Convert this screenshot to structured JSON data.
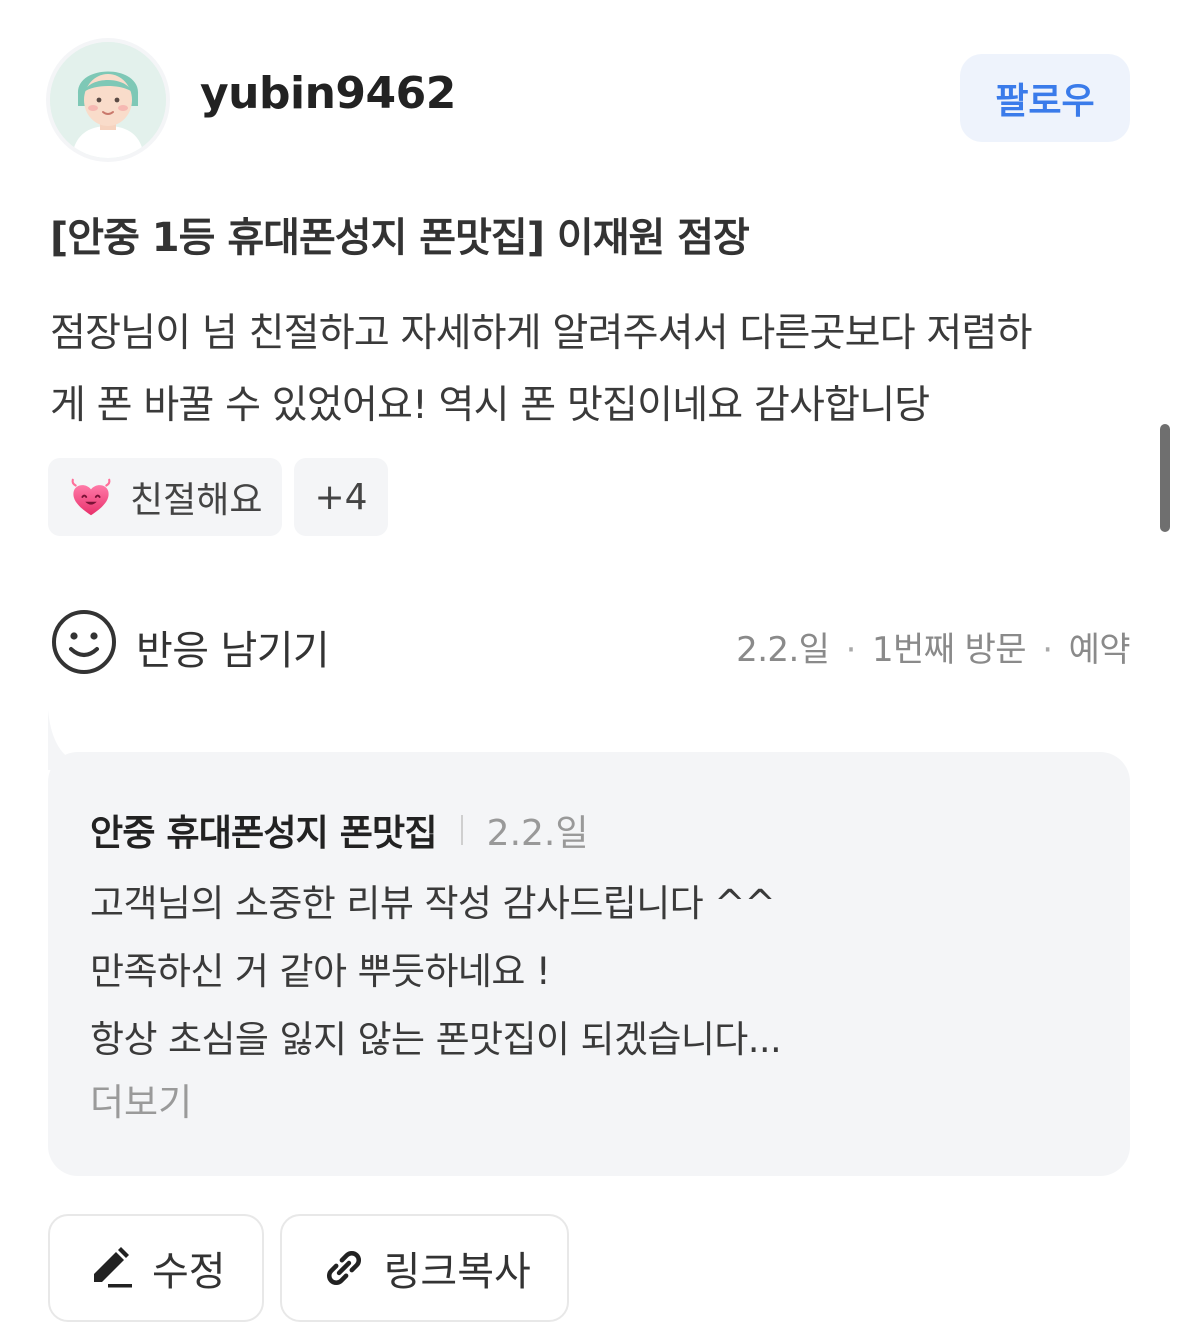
{
  "profile": {
    "username": "yubin9462",
    "follow_label": "팔로우"
  },
  "review": {
    "title": "[안중 1등 휴대폰성지 폰맛집] 이재원 점장",
    "body_lines": [
      "점장님이 넘 친절하고 자세하게 알려주셔서 다른곳보다 저렴하",
      "게 폰 바꿀 수 있었어요! 역시 폰 맛집이네요 감사합니당"
    ],
    "tags": [
      {
        "icon": "heart-smile-icon",
        "label": "친절해요"
      },
      {
        "label": "+4"
      }
    ]
  },
  "reaction": {
    "label": "반응 남기기",
    "date": "2.2.일",
    "visit": "1번째 방문",
    "type": "예약",
    "dot": "·"
  },
  "reply": {
    "store_name": "안중 휴대폰성지 폰맛집",
    "date": "2.2.일",
    "lines": [
      "고객님의 소중한 리뷰 작성 감사드립니다 ^^",
      "만족하신 거 같아 뿌듯하네요 !",
      "항상 초심을 잃지 않는 폰맛집이 되겠습니다..."
    ],
    "more_label": "더보기"
  },
  "actions": {
    "edit_label": "수정",
    "copy_link_label": "링크복사"
  },
  "colors": {
    "accent": "#3a7bea",
    "follow_bg": "#eef3fc",
    "panel_bg": "#f4f5f7"
  }
}
